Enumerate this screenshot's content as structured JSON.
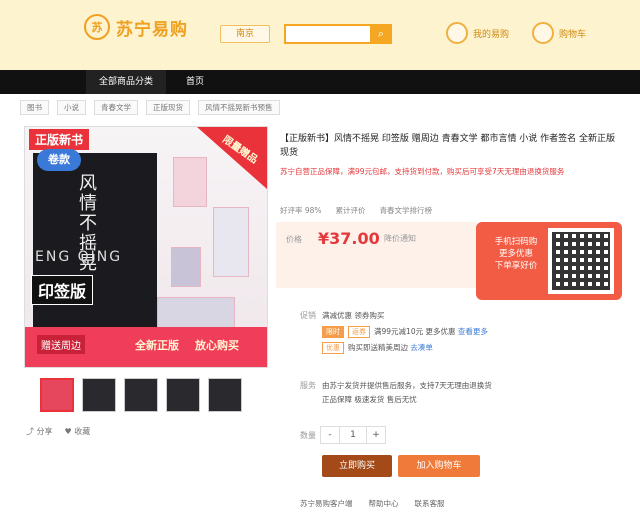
{
  "header": {
    "logo_text": "苏宁易购",
    "city": "南京",
    "search_placeholder": "",
    "search_icon": "search-icon",
    "link_1": "我的易购",
    "link_2": "购物车",
    "accent": "#f5a623"
  },
  "nav": {
    "category": "全部商品分类",
    "home": "首页"
  },
  "breadcrumb": [
    "图书",
    "小说",
    "青春文学",
    "正版现货",
    "风情不摇晃新书预售"
  ],
  "product": {
    "badge_new": "正版新书",
    "badge_vol": "卷款",
    "book_title": "风情不摇晃",
    "book_en": "ENG QING",
    "sign_edition": "印签版",
    "corner_tag": "限量赠品",
    "ribbon_a": "赠送周边",
    "ribbon_b": "全新正版",
    "ribbon_c": "放心购买",
    "title": "【正版新书】风情不摇晃 印签版 赠周边 青春文学 都市言情 小说 作者签名 全新正版 现货",
    "promo": "苏宁自营正品保障，满99元包邮，支持货到付款，购买后可享受7天无理由退换货服务",
    "meta": [
      "好评率 98%",
      "累计评价",
      "青春文学排行榜"
    ],
    "price_label": "价格",
    "price": "¥37.00",
    "price_sub": "降价通知",
    "qr_text_1": "手机扫码购",
    "qr_text_2": "更多优惠",
    "qr_text_3": "下单享好价",
    "row_promo_label": "促销",
    "row_promo": "满减优惠 领券购买",
    "tag_1": "限时",
    "tag_2": "返券",
    "row_promo_detail": "满99元减10元 更多优惠",
    "row_promo_link": "查看更多",
    "tag_3": "优惠",
    "row_promo_detail_2": "购买即送精美周边",
    "row_promo_link_2": "去凑单",
    "row_service_label": "服务",
    "row_service": "由苏宁发货并提供售后服务，支持7天无理由退换货",
    "row_service_2": "正品保障 极速发货 售后无忧",
    "row_qty_label": "数量",
    "qty_value": "1",
    "qty_minus": "-",
    "qty_plus": "+",
    "buy_now": "立即购买",
    "add_cart": "加入购物车",
    "share": "分享",
    "favorite": "收藏",
    "bottom_link_1": "苏宁易购客户端",
    "bottom_link_2": "帮助中心",
    "bottom_link_3": "联系客服"
  }
}
